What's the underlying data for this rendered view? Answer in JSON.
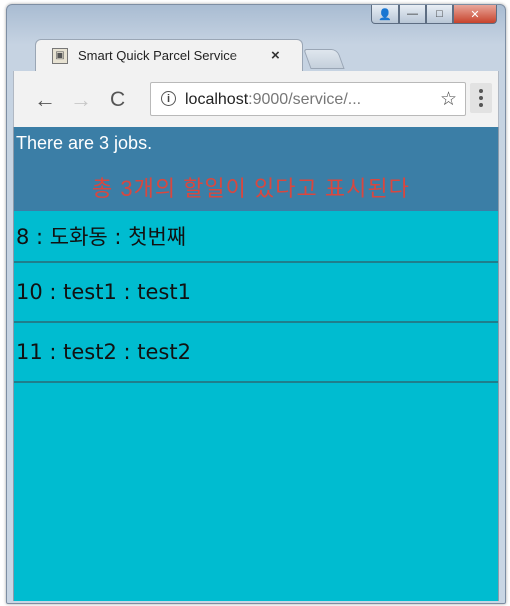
{
  "window": {
    "controls": {
      "user_glyph": "👤",
      "minimize_glyph": "—",
      "maximize_glyph": "□",
      "close_glyph": "✕"
    }
  },
  "tab": {
    "title": "Smart Quick Parcel Service",
    "close_glyph": "×",
    "favicon_glyph": "▣"
  },
  "toolbar": {
    "back_glyph": "←",
    "forward_glyph": "→",
    "reload_glyph": "C",
    "info_glyph": "i",
    "url_host": "localhost",
    "url_rest": ":9000/service/...",
    "star_glyph": "☆"
  },
  "page": {
    "job_count_text": "There are 3 jobs.",
    "annotation_text": "총 3개의 할일이 있다고 표시된다",
    "jobs": [
      "8 : 도화동 : 첫번째",
      "10 : test1 : test1",
      "11 : test2 : test2"
    ]
  },
  "colors": {
    "content_bg": "#00bcd0",
    "header_bg": "#3b7ea6",
    "annotation": "#d9473f",
    "divider": "#1f7f8c"
  }
}
